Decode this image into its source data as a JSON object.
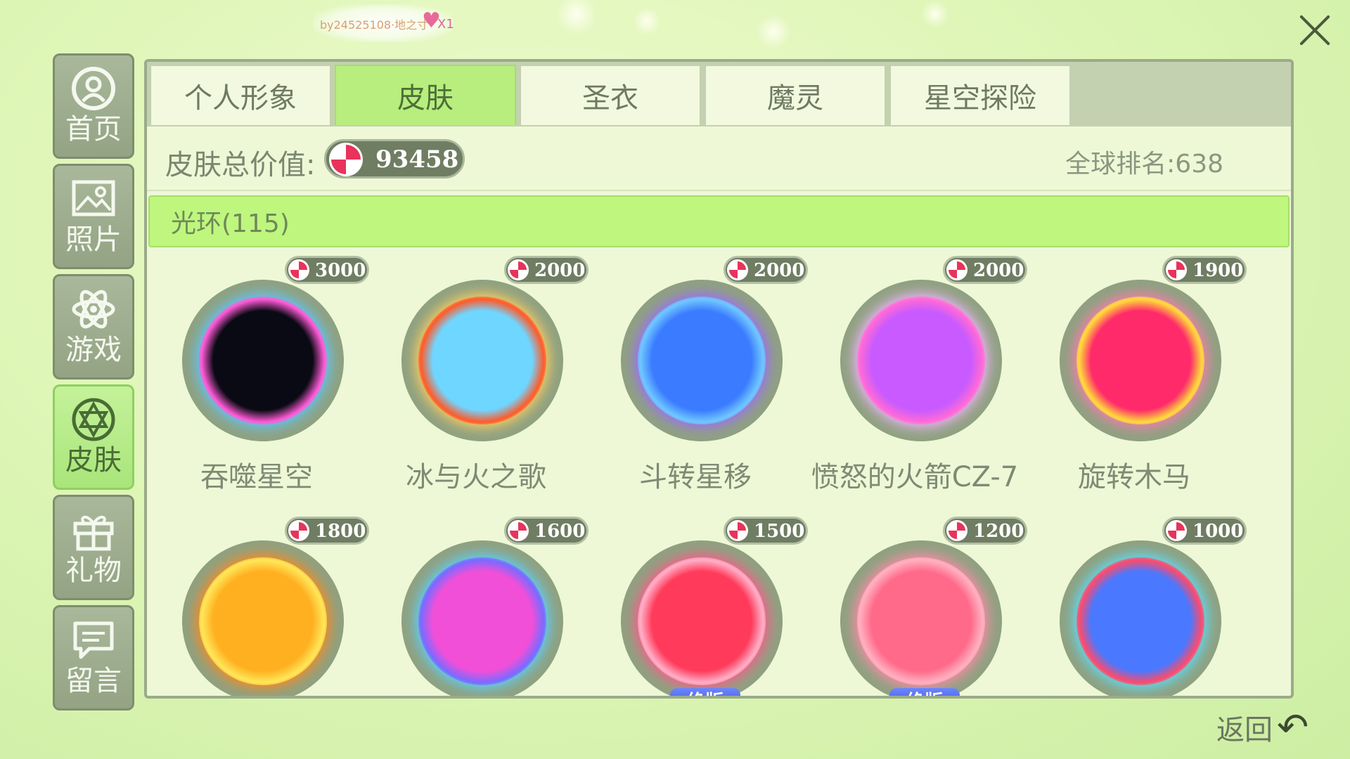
{
  "header": {
    "deco_text": "by24525108·地之寸",
    "deco_count": "X1",
    "close_icon": "close-icon"
  },
  "sidebar": {
    "items": [
      {
        "label": "首页",
        "icon": "home-icon",
        "active": false
      },
      {
        "label": "照片",
        "icon": "photo-icon",
        "active": false
      },
      {
        "label": "游戏",
        "icon": "game-icon",
        "active": false
      },
      {
        "label": "皮肤",
        "icon": "skin-icon",
        "active": true
      },
      {
        "label": "礼物",
        "icon": "gift-icon",
        "active": false
      },
      {
        "label": "留言",
        "icon": "message-icon",
        "active": false
      }
    ]
  },
  "tabs": [
    {
      "label": "个人形象",
      "active": false
    },
    {
      "label": "皮肤",
      "active": true
    },
    {
      "label": "圣衣",
      "active": false
    },
    {
      "label": "魔灵",
      "active": false
    },
    {
      "label": "星空探险",
      "active": false
    }
  ],
  "summary": {
    "label": "皮肤总价值:",
    "value": "93458",
    "rank": "全球排名:638"
  },
  "category": {
    "label": "光环(115)"
  },
  "items": [
    {
      "name": "吞噬星空",
      "price": "3000",
      "colors": [
        "#0a0a14",
        "#ff5ad6",
        "#5cc8ff"
      ],
      "badge": ""
    },
    {
      "name": "冰与火之歌",
      "price": "2000",
      "colors": [
        "#6fd6ff",
        "#ff5a2a",
        "#ffd060"
      ],
      "badge": ""
    },
    {
      "name": "斗转星移",
      "price": "2000",
      "colors": [
        "#3b7bff",
        "#6fc8ff",
        "#9b6cff"
      ],
      "badge": ""
    },
    {
      "name": "愤怒的火箭CZ-7",
      "price": "2000",
      "colors": [
        "#c85aff",
        "#ff6ad6",
        "#f2b3ff"
      ],
      "badge": ""
    },
    {
      "name": "旋转木马",
      "price": "1900",
      "colors": [
        "#ff2a6a",
        "#ffdc3a",
        "#ff7ab0"
      ],
      "badge": ""
    },
    {
      "name": "",
      "price": "1800",
      "colors": [
        "#ffb020",
        "#ffe85a",
        "#ff8a1a"
      ],
      "badge": ""
    },
    {
      "name": "",
      "price": "1600",
      "colors": [
        "#f24fd8",
        "#7a6aff",
        "#5ad2ff"
      ],
      "badge": ""
    },
    {
      "name": "",
      "price": "1500",
      "colors": [
        "#ff3a5a",
        "#ffb0c8",
        "#ff5a8a"
      ],
      "badge": "绝版"
    },
    {
      "name": "",
      "price": "1200",
      "colors": [
        "#ff6a8a",
        "#ffb0c0",
        "#ff8aa8"
      ],
      "badge": "绝版"
    },
    {
      "name": "",
      "price": "1000",
      "colors": [
        "#4a78ff",
        "#ff4a6a",
        "#5ae0ff"
      ],
      "badge": ""
    }
  ],
  "footer": {
    "back_label": "返回"
  }
}
